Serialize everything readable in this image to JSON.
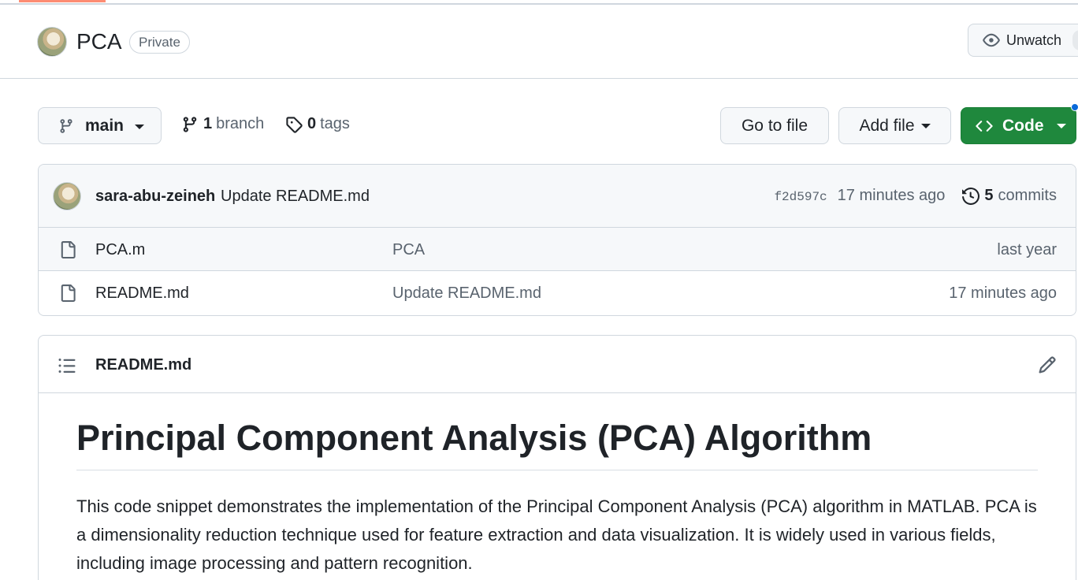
{
  "repo": {
    "name": "PCA",
    "visibility": "Private",
    "watch_label": "Unwatch"
  },
  "toolbar": {
    "branch": "main",
    "branch_count": "1",
    "branch_label": "branch",
    "tag_count": "0",
    "tag_label": "tags",
    "goto_file": "Go to file",
    "add_file": "Add file",
    "code": "Code"
  },
  "latest_commit": {
    "author": "sara-abu-zeineh",
    "message": "Update README.md",
    "sha": "f2d597c",
    "time": "17 minutes ago",
    "commit_count": "5",
    "commits_label": "commits"
  },
  "files": [
    {
      "name": "PCA.m",
      "message": "PCA",
      "age": "last year"
    },
    {
      "name": "README.md",
      "message": "Update README.md",
      "age": "17 minutes ago"
    }
  ],
  "readme": {
    "filename": "README.md",
    "heading": "Principal Component Analysis (PCA) Algorithm",
    "paragraph": "This code snippet demonstrates the implementation of the Principal Component Analysis (PCA) algorithm in MATLAB. PCA is a dimensionality reduction technique used for feature extraction and data visualization. It is widely used in various fields, including image processing and pattern recognition."
  },
  "colors": {
    "accent_green": "#1f883d",
    "muted_text": "#59636e",
    "border": "#d0d7de",
    "tab_underline": "#fd8c73"
  }
}
